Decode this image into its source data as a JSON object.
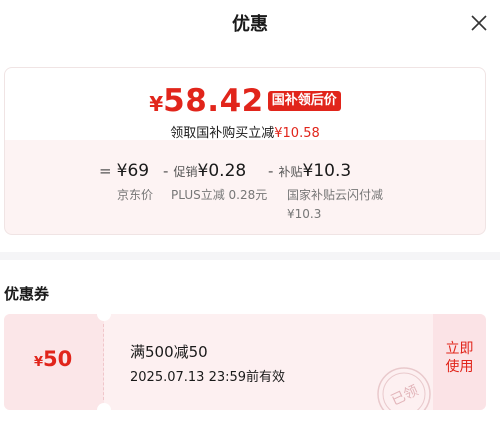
{
  "header": {
    "title": "优惠"
  },
  "price": {
    "currency": "¥",
    "amount": "58.42",
    "badge": "国补领后价",
    "sub_prefix": "领取国补购买立减",
    "sub_amount": "¥10.58"
  },
  "formula": {
    "equals": "=",
    "base": "¥69",
    "minus1": "-",
    "promo_label": "促销",
    "promo_value": "¥0.28",
    "minus2": "-",
    "subsidy_label": "补贴",
    "subsidy_value": "¥10.3",
    "cap_base": "京东价",
    "cap_promo": "PLUS立减 0.28元",
    "cap_subsidy_line1": "国家补贴云闪付减",
    "cap_subsidy_line2": "¥10.3"
  },
  "coupons_section": {
    "title": "优惠券"
  },
  "coupon": {
    "currency": "¥",
    "value": "50",
    "condition": "满500减50",
    "valid_until": "2025.07.13 23:59前有效",
    "use_line1": "立即",
    "use_line2": "使用",
    "stamp_text": "已领"
  },
  "colors": {
    "accent": "#e1251b",
    "card_tint": "#fdf3f3",
    "coupon_bg": "#fdf0f1"
  }
}
